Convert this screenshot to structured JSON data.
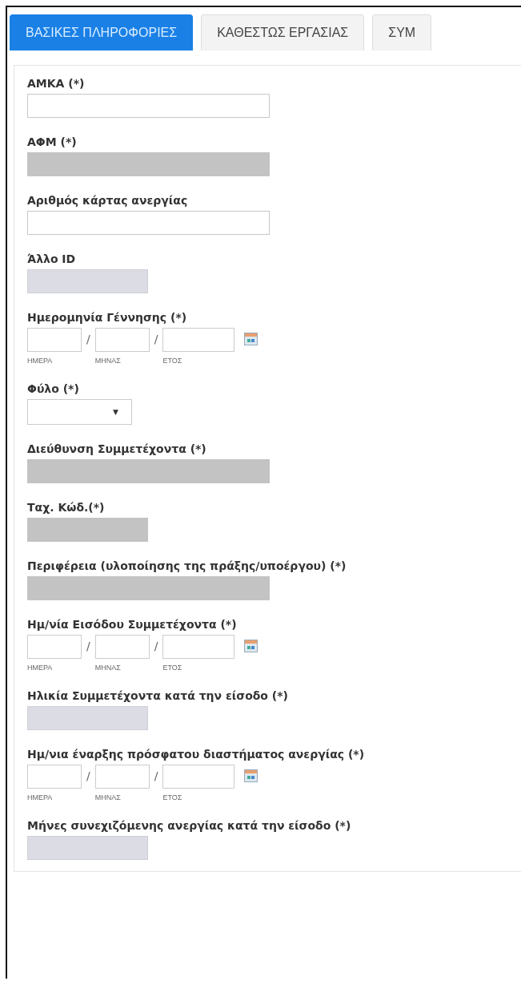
{
  "tabs": [
    {
      "label": "ΒΑΣΙΚΕΣ ΠΛΗΡΟΦΟΡΙΕΣ",
      "selected": true
    },
    {
      "label": "ΚΑΘΕΣΤΩΣ ΕΡΓΑΣΙΑΣ",
      "selected": false
    },
    {
      "label": "ΣΥΜ",
      "selected": false
    }
  ],
  "fields": [
    {
      "label": "ΑΜΚΑ (*)",
      "kind": "text"
    },
    {
      "label": "ΑΦΜ (*)",
      "kind": "locked"
    },
    {
      "label": "Αριθμός κάρτας ανεργίας",
      "kind": "text"
    },
    {
      "label": "Άλλο ID",
      "kind": "short"
    },
    {
      "label": "Ημερομηνία Γέννησης (*)",
      "kind": "date",
      "parts": [
        "ΗΜΕΡΑ",
        "ΜΗΝΑΣ",
        "ΕΤΟΣ"
      ],
      "separators": [
        "/",
        "/"
      ]
    },
    {
      "label": "Φύλο (*)",
      "kind": "select",
      "arrow": "▼"
    },
    {
      "label": "Διεύθυνση Συμμετέχοντα (*)",
      "kind": "locked"
    },
    {
      "label": "Ταχ. Κώδ.(*)",
      "kind": "locked-short"
    },
    {
      "label": "Περιφέρεια (υλοποίησης της πράξης/υποέργου) (*)",
      "kind": "locked"
    },
    {
      "label": "Ημ/νία Εισόδου Συμμετέχοντα (*)",
      "kind": "date",
      "parts": [
        "ΗΜΕΡΑ",
        "ΜΗΝΑΣ",
        "ΕΤΟΣ"
      ],
      "separators": [
        "/",
        "/"
      ]
    },
    {
      "label": "Ηλικία Συμμετέχοντα κατά την είσοδο (*)",
      "kind": "short"
    },
    {
      "label": "Ημ/νια έναρξης πρόσφατου διαστήματος ανεργίας (*)",
      "kind": "date",
      "parts": [
        "ΗΜΕΡΑ",
        "ΜΗΝΑΣ",
        "ΕΤΟΣ"
      ],
      "separators": [
        "/",
        "/"
      ]
    },
    {
      "label": "Μήνες συνεχιζόμενης ανεργίας κατά την είσοδο (*)",
      "kind": "short"
    }
  ]
}
